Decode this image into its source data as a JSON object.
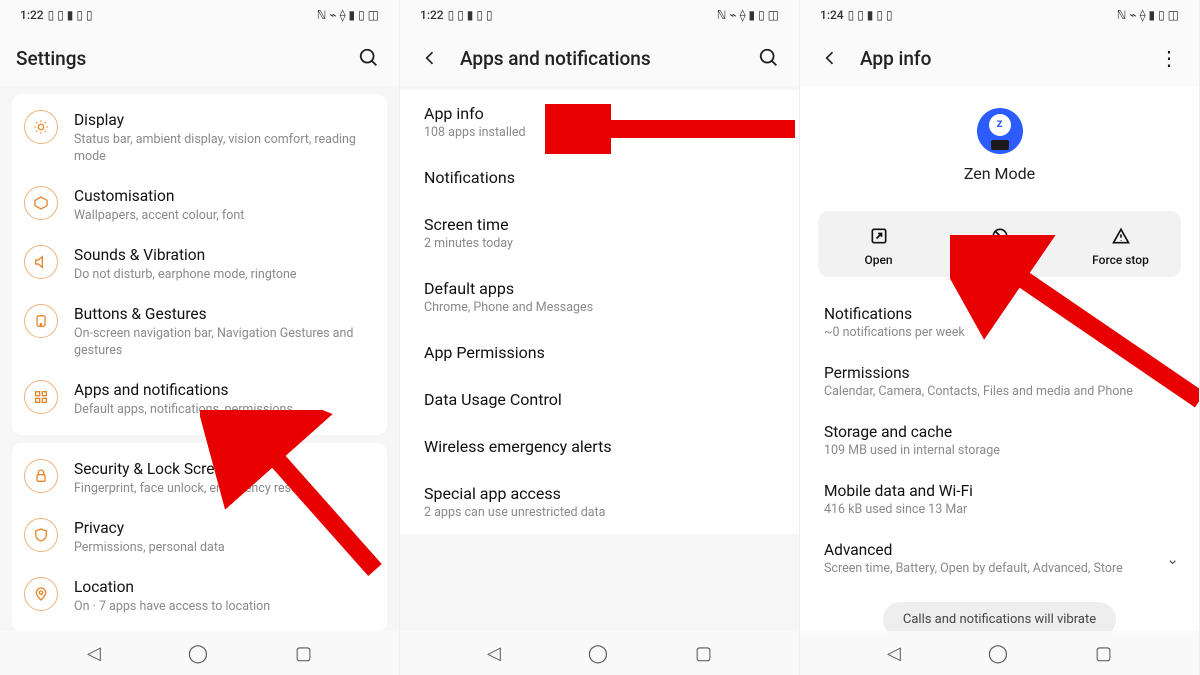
{
  "screen1": {
    "clock": "1:22",
    "title": "Settings",
    "group1": [
      {
        "icon": "display-icon",
        "label": "Display",
        "sub": "Status bar, ambient display, vision comfort, reading mode"
      },
      {
        "icon": "customisation-icon",
        "label": "Customisation",
        "sub": "Wallpapers, accent colour, font"
      },
      {
        "icon": "sounds-icon",
        "label": "Sounds & Vibration",
        "sub": "Do not disturb, earphone mode, ringtone"
      },
      {
        "icon": "buttons-icon",
        "label": "Buttons & Gestures",
        "sub": "On-screen navigation bar, Navigation Gestures and gestures"
      },
      {
        "icon": "apps-icon",
        "label": "Apps and notifications",
        "sub": "Default apps, notifications, permissions"
      }
    ],
    "group2": [
      {
        "icon": "security-icon",
        "label": "Security & Lock Screen",
        "sub": "Fingerprint, face unlock, emergency rescue"
      },
      {
        "icon": "privacy-icon",
        "label": "Privacy",
        "sub": "Permissions, personal data"
      },
      {
        "icon": "location-icon",
        "label": "Location",
        "sub": "On · 7 apps have access to location"
      }
    ]
  },
  "screen2": {
    "clock": "1:22",
    "title": "Apps and notifications",
    "items": [
      {
        "label": "App info",
        "sub": "108 apps installed"
      },
      {
        "label": "Notifications",
        "sub": ""
      },
      {
        "label": "Screen time",
        "sub": "2 minutes today"
      },
      {
        "label": "Default apps",
        "sub": "Chrome, Phone and Messages"
      },
      {
        "label": "App Permissions",
        "sub": ""
      },
      {
        "label": "Data Usage Control",
        "sub": ""
      },
      {
        "label": "Wireless emergency alerts",
        "sub": ""
      },
      {
        "label": "Special app access",
        "sub": "2 apps can use unrestricted data"
      }
    ]
  },
  "screen3": {
    "clock": "1:24",
    "title": "App info",
    "app_name": "Zen Mode",
    "actions": {
      "open": "Open",
      "disable": "Disable",
      "forcestop": "Force stop"
    },
    "rows": {
      "notifications": {
        "label": "Notifications",
        "sub": "~0 notifications per week"
      },
      "permissions": {
        "label": "Permissions",
        "sub": "Calendar, Camera, Contacts, Files and media and Phone"
      },
      "storage": {
        "label": "Storage and cache",
        "sub": "109 MB used in internal storage"
      },
      "mobiledata": {
        "label": "Mobile data and Wi-Fi",
        "sub": "416 kB used since 13 Mar"
      },
      "advanced": {
        "label": "Advanced",
        "sub": "Screen time, Battery, Open by default, Advanced, Store"
      }
    },
    "chip": "Calls and notifications will vibrate"
  }
}
